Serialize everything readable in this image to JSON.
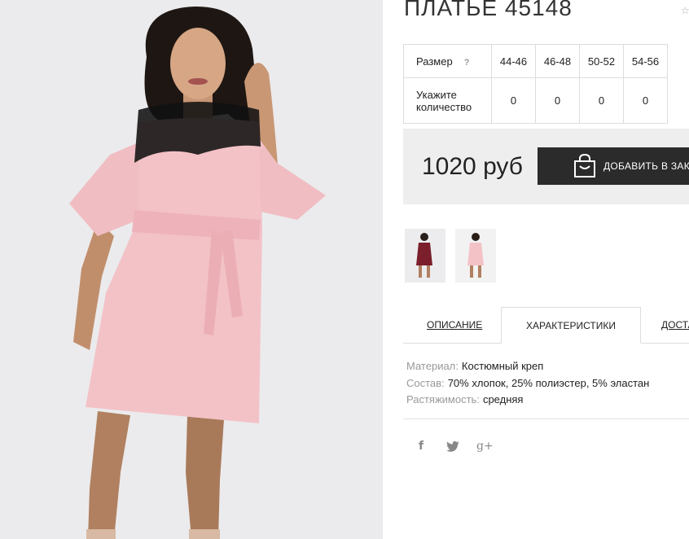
{
  "product": {
    "title": "ПЛАТЬЕ 45148",
    "price": "1020 руб",
    "add_to_cart_label": "ДОБАВИТЬ В ЗАКАЗ"
  },
  "size_table": {
    "size_label": "Размер",
    "help_mark": "?",
    "quantity_label_1": "Укажите",
    "quantity_label_2": "количество",
    "sizes": [
      "44-46",
      "46-48",
      "50-52",
      "54-56"
    ],
    "quantities": [
      "0",
      "0",
      "0",
      "0"
    ]
  },
  "thumbnails": [
    {
      "name": "thumb-burgundy-dress",
      "color": "#7a1f2b"
    },
    {
      "name": "thumb-pink-dress",
      "color": "#f3c2c7"
    }
  ],
  "tabs": [
    {
      "label": "ОПИСАНИЕ",
      "active": false
    },
    {
      "label": "ХАРАКТЕРИСТИКИ",
      "active": true
    },
    {
      "label": "ДОСТАВКА",
      "active": false
    }
  ],
  "properties": [
    {
      "key": "Материал:",
      "value": "Костюмный креп"
    },
    {
      "key": "Состав:",
      "value": "70% хлопок, 25% полиэстер, 5% эластан"
    },
    {
      "key": "Растяжимость:",
      "value": "средняя"
    }
  ],
  "social": {
    "facebook": "f",
    "twitter": "twitter-bird",
    "google_plus": "g+"
  },
  "colors": {
    "dress_pink": "#f3c2c7",
    "lace_black": "#111111",
    "button_dark": "#2b2b2b",
    "price_box_bg": "#eeeeee"
  }
}
